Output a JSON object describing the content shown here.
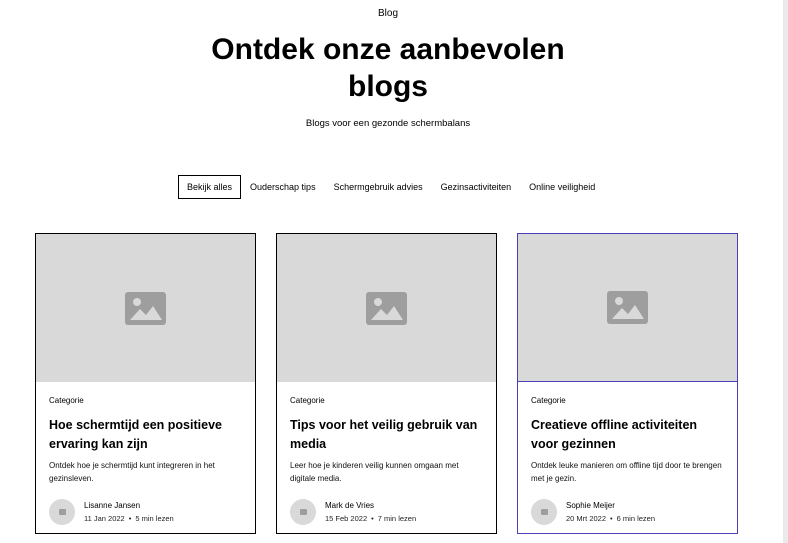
{
  "header": {
    "tagline": "Blog",
    "title": "Ontdek onze aanbevolen blogs",
    "subtitle": "Blogs voor een gezonde schermbalans"
  },
  "tabs": [
    {
      "label": "Bekijk alles",
      "active": true
    },
    {
      "label": "Ouderschap tips"
    },
    {
      "label": "Schermgebruik advies"
    },
    {
      "label": "Gezinsactiviteiten"
    },
    {
      "label": "Online veiligheid"
    }
  ],
  "cards": [
    {
      "category": "Categorie",
      "title": "Hoe schermtijd een positieve ervaring kan zijn",
      "description": "Ontdek hoe je schermtijd kunt integreren in het gezinsleven.",
      "author": "Lisanne Jansen",
      "date": "11 Jan 2022",
      "read_time": "5 min lezen"
    },
    {
      "category": "Categorie",
      "title": "Tips voor het veilig gebruik van media",
      "description": "Leer hoe je kinderen veilig kunnen omgaan met digitale media.",
      "author": "Mark de Vries",
      "date": "15 Feb 2022",
      "read_time": "7 min lezen"
    },
    {
      "category": "Categorie",
      "title": "Creatieve offline activiteiten voor gezinnen",
      "description": "Ontdek leuke manieren om offline tijd door te brengen met je gezin.",
      "author": "Sophie Meijer",
      "date": "20 Mrt 2022",
      "read_time": "6 min lezen"
    }
  ],
  "meta_separator": "•",
  "colors": {
    "placeholder": "#d9d9d9",
    "placeholder_icon": "#9e9e9e",
    "selected_border": "#4b3fb8"
  },
  "icons": {
    "card_image": "image-placeholder-icon",
    "avatar": "avatar-placeholder-icon"
  }
}
